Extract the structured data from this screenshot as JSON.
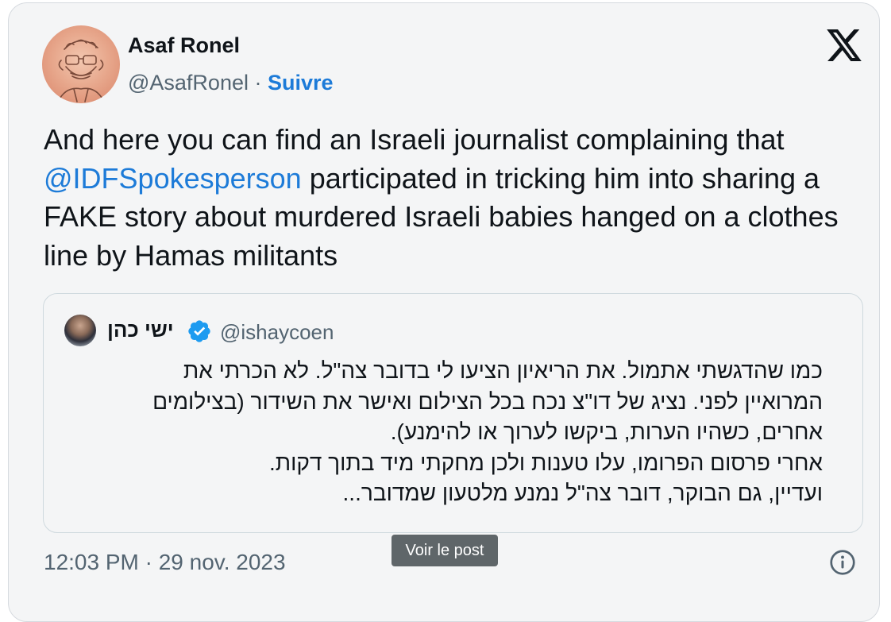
{
  "author": {
    "name": "Asaf Ronel",
    "handle": "@AsafRonel",
    "separator": "·",
    "follow_label": "Suivre"
  },
  "icons": {
    "close": "x-logo-icon",
    "verified": "verified-badge-icon",
    "info": "info-icon"
  },
  "tweet": {
    "text_before": "And here you can find an Israeli journalist complaining that",
    "mention": "@IDFSpokesperson",
    "text_after": " participated in tricking him into sharing a FAKE story about murdered Israeli babies hanged on a clothes line by Hamas militants"
  },
  "quote": {
    "name": "ישי כהן",
    "handle": "@ishaycoen",
    "lines": [
      "כמו שהדגשתי אתמול. את הריאיון הציעו לי בדובר צה\"ל. לא הכרתי את",
      "המרואיין לפני. נציג של דו\"צ נכח בכל הצילום ואישר את השידור (בצילומים",
      "אחרים, כשהיו הערות, ביקשו לערוך או להימנע).",
      "אחרי פרסום הפרומו, עלו טענות ולכן מחקתי מיד בתוך דקות.",
      "ועדיין, גם הבוקר, דובר צה\"ל נמנע מלטעון שמדובר..."
    ]
  },
  "timestamp": "12:03 PM · 29 nov. 2023",
  "tooltip": "Voir le post",
  "colors": {
    "link": "#1d7bd8",
    "secondary_text": "#536471",
    "card_bg": "#f4f5f6",
    "verified": "#1d9bf0"
  }
}
